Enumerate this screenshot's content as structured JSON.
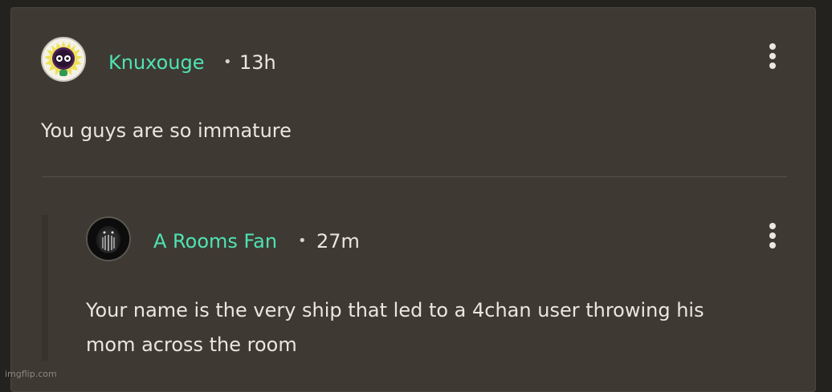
{
  "comment": {
    "username": "Knuxouge",
    "separator": "•",
    "time": "13h",
    "text": "You guys are so immature"
  },
  "reply": {
    "username": "A Rooms Fan",
    "separator": "•",
    "time": "27m",
    "text_line1": "Your name is the very ship that led to a 4chan user throwing his",
    "text_line2": "mom across the room"
  },
  "watermark": "imgflip.com",
  "colors": {
    "background": "#24221e",
    "card": "#3e3a33",
    "username": "#4fe3b4",
    "text": "#ebe7df"
  },
  "icons": {
    "comment_avatar": "fuzzy-creature-avatar",
    "reply_avatar": "dark-creature-avatar",
    "menu": "more-vertical-icon"
  }
}
